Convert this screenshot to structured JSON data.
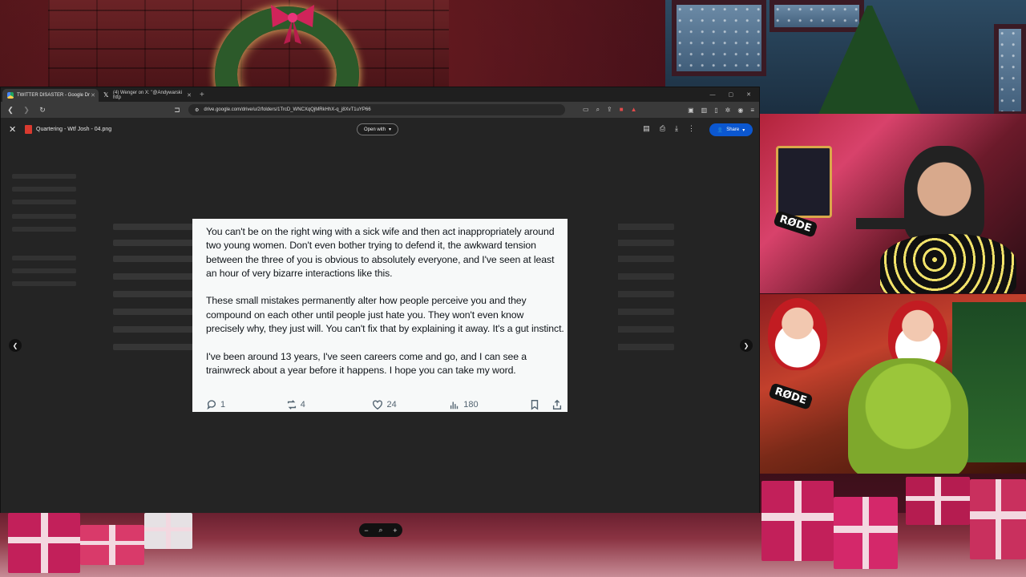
{
  "browser": {
    "tabs": [
      {
        "label": "TWITTER DISASTER - Google Dr",
        "active": true,
        "favicon": "google-drive-icon"
      },
      {
        "label": "(4) Wenger on X: \"@Andywarski http",
        "active": false,
        "favicon": "x-icon"
      }
    ],
    "url": "drive.google.com/drive/u/2/folders/1TrcD_WNCXqQjMRkHhX-q_j8XvT1uYP66"
  },
  "viewer": {
    "file_name": "Quartering - Wtf Josh - 04.png",
    "open_with_label": "Open with",
    "share_label": "Share",
    "zoom_out": "−",
    "zoom_in": "+"
  },
  "tweet": {
    "paragraphs": [
      "You can't be on the right wing with a sick wife and then act inappropriately around two young women. Don't even bother trying to defend it, the awkward tension between the three of you is obvious to absolutely everyone, and I've seen at least an hour of very bizarre interactions like this.",
      "These small mistakes permanently alter how people perceive you and they compound on each other until people just hate you. They won't even know precisely why, they just will. You can't fix that by explaining it away. It's a gut instinct.",
      "I've been around 13 years, I've seen careers come and go, and I can see a trainwreck about a year before it happens. I hope you can take my word."
    ],
    "replies": "1",
    "reposts": "4",
    "likes": "24",
    "views": "180"
  },
  "overlay": {
    "mic_brand": "RØDE"
  },
  "colors": {
    "share_button": "#0b57d0",
    "viewer_bg": "#242424",
    "tweet_bg": "#f7f9f9"
  }
}
